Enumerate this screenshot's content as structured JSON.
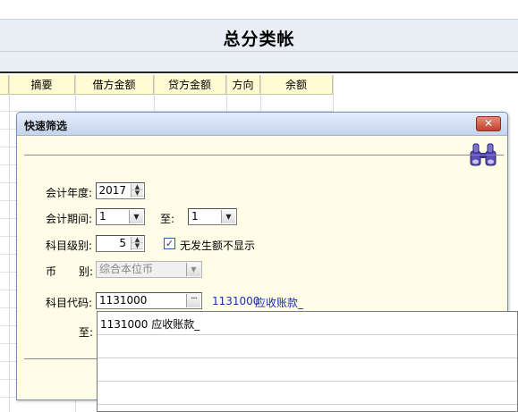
{
  "report": {
    "title": "总分类帐"
  },
  "ledger": {
    "columns": [
      "摘要",
      "借方金额",
      "贷方金额",
      "方向",
      "余额"
    ]
  },
  "dialog": {
    "title": "快速筛选",
    "close_symbol": "✕",
    "fiscal_year": {
      "label": "会计年度:",
      "value": "2017"
    },
    "period": {
      "label": "会计期间:",
      "from": "1",
      "to_label": "至:",
      "to": "1"
    },
    "subject_level": {
      "label": "科目级别:",
      "value": "5"
    },
    "hide_no_activity": {
      "label": "无发生额不显示",
      "checked": true,
      "mark": "✓"
    },
    "currency": {
      "label_1": "币",
      "label_2": "别:",
      "value": "综合本位币"
    },
    "subject_code": {
      "label": "科目代码:",
      "value": "1131000",
      "lookup_symbol": "···",
      "resolved_code": "1131000",
      "resolved_name": "应收账款_",
      "to_label": "至:"
    }
  },
  "autocomplete": {
    "items": [
      "1131000  应收账款_",
      "",
      "",
      ""
    ]
  }
}
